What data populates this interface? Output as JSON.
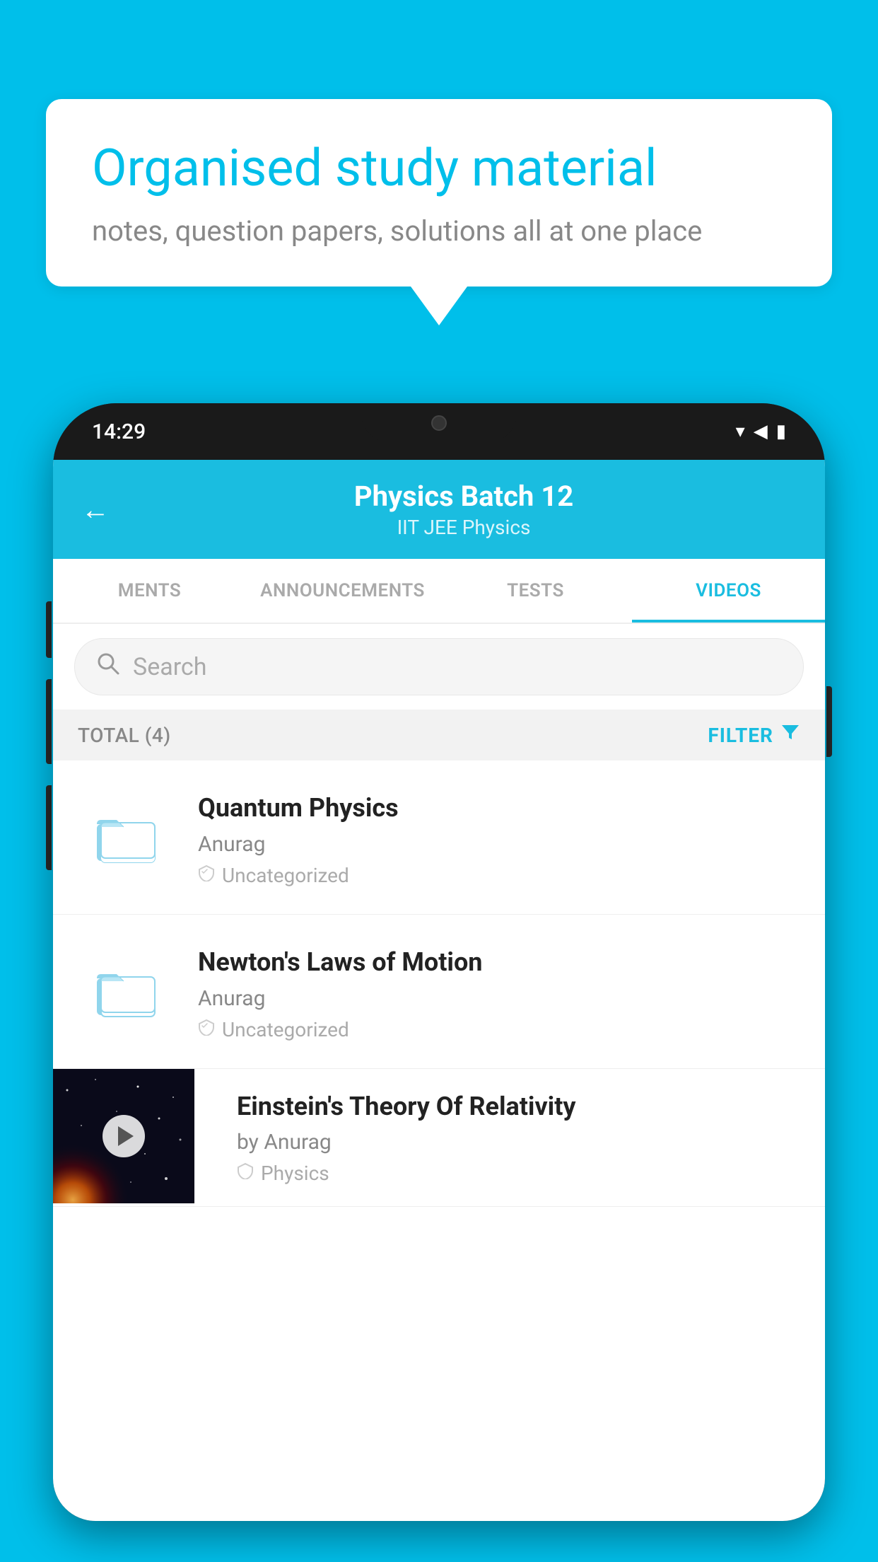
{
  "background_color": "#00BFEA",
  "speech_bubble": {
    "title": "Organised study material",
    "subtitle": "notes, question papers, solutions all at one place"
  },
  "phone": {
    "status_bar": {
      "time": "14:29",
      "wifi": "▾",
      "signal": "▾",
      "battery": "▮"
    },
    "header": {
      "back_label": "←",
      "title": "Physics Batch 12",
      "subtitle": "IIT JEE   Physics"
    },
    "tabs": [
      {
        "label": "MENTS",
        "active": false
      },
      {
        "label": "ANNOUNCEMENTS",
        "active": false
      },
      {
        "label": "TESTS",
        "active": false
      },
      {
        "label": "VIDEOS",
        "active": true
      }
    ],
    "search": {
      "placeholder": "Search"
    },
    "filter": {
      "total_label": "TOTAL (4)",
      "filter_label": "FILTER"
    },
    "videos": [
      {
        "id": 1,
        "title": "Quantum Physics",
        "author": "Anurag",
        "tag": "Uncategorized",
        "has_thumb": false
      },
      {
        "id": 2,
        "title": "Newton's Laws of Motion",
        "author": "Anurag",
        "tag": "Uncategorized",
        "has_thumb": false
      },
      {
        "id": 3,
        "title": "Einstein's Theory Of Relativity",
        "author": "by Anurag",
        "tag": "Physics",
        "has_thumb": true
      }
    ]
  }
}
